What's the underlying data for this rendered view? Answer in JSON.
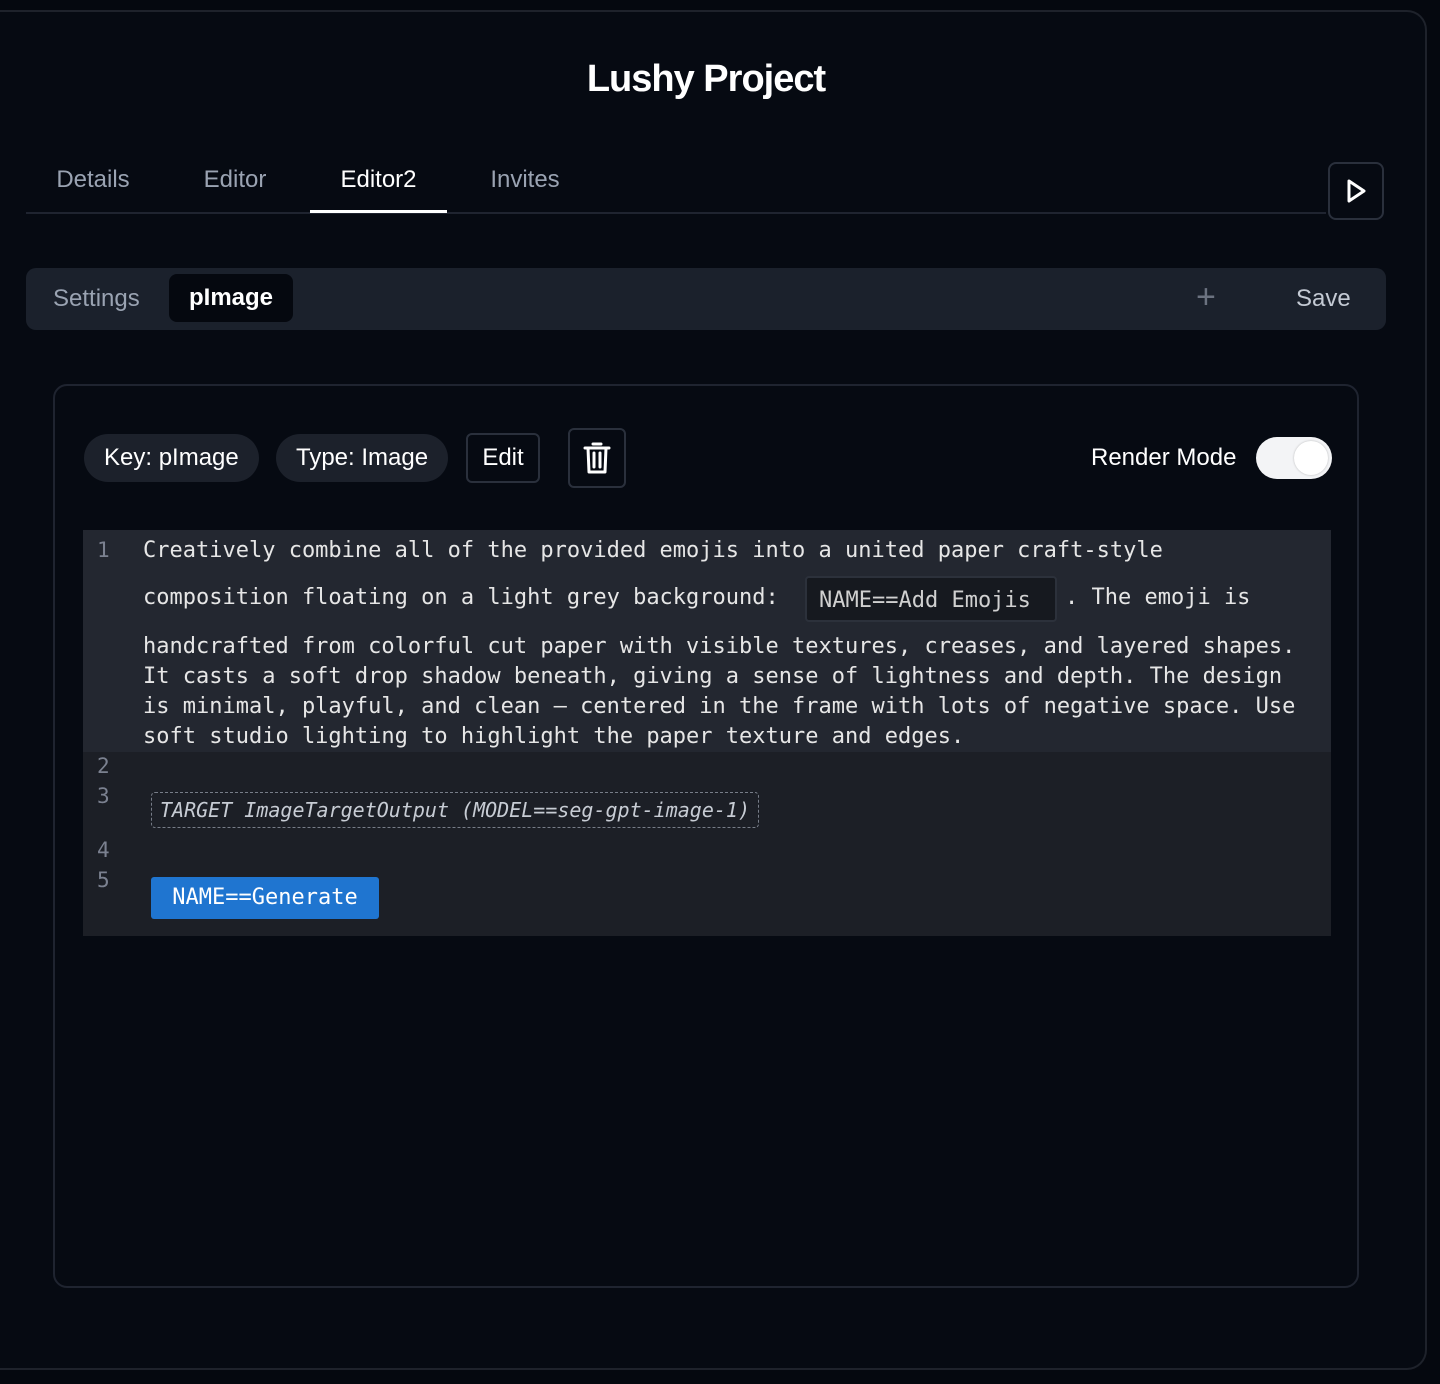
{
  "project": {
    "title": "Lushy Project"
  },
  "tabs": [
    {
      "label": "Details"
    },
    {
      "label": "Editor"
    },
    {
      "label": "Editor2"
    },
    {
      "label": "Invites"
    }
  ],
  "active_tab": "Editor2",
  "run_button": {
    "icon": "play-icon"
  },
  "subtabs": [
    {
      "label": "Settings"
    },
    {
      "label": "pImage"
    }
  ],
  "subbar": {
    "add_icon": "plus-icon",
    "add_symbol": "+",
    "save_label": "Save"
  },
  "block": {
    "key_label": "Key: pImage",
    "type_label": "Type: Image",
    "edit_label": "Edit",
    "delete_icon": "trash-icon",
    "render_mode_label": "Render Mode",
    "render_mode_on": true
  },
  "editor": {
    "line_numbers": [
      "1",
      "2",
      "3",
      "4",
      "5"
    ],
    "line1": {
      "row1": "Creatively combine all of the provided emojis into a united paper craft-style",
      "row2_before": "composition floating on a light grey background:",
      "inline_input": "NAME==Add Emojis",
      "row2_after": ". The emoji is",
      "row3": "handcrafted from colorful cut paper with visible textures, creases, and layered shapes.",
      "row4": "It casts a soft drop shadow beneath, giving a sense of lightness and depth. The design",
      "row5": "is minimal, playful, and clean — centered in the frame with lots of negative space. Use",
      "row6": "soft studio lighting to highlight the paper texture and edges."
    },
    "target_chip": "TARGET ImageTargetOutput (MODEL==seg-gpt-image-1)",
    "generate_button": "NAME==Generate"
  },
  "colors": {
    "background": "#05080f",
    "accent_blue": "#1f75d0",
    "subbar": "#1b212c",
    "editor_bg": "#1c1f26"
  }
}
